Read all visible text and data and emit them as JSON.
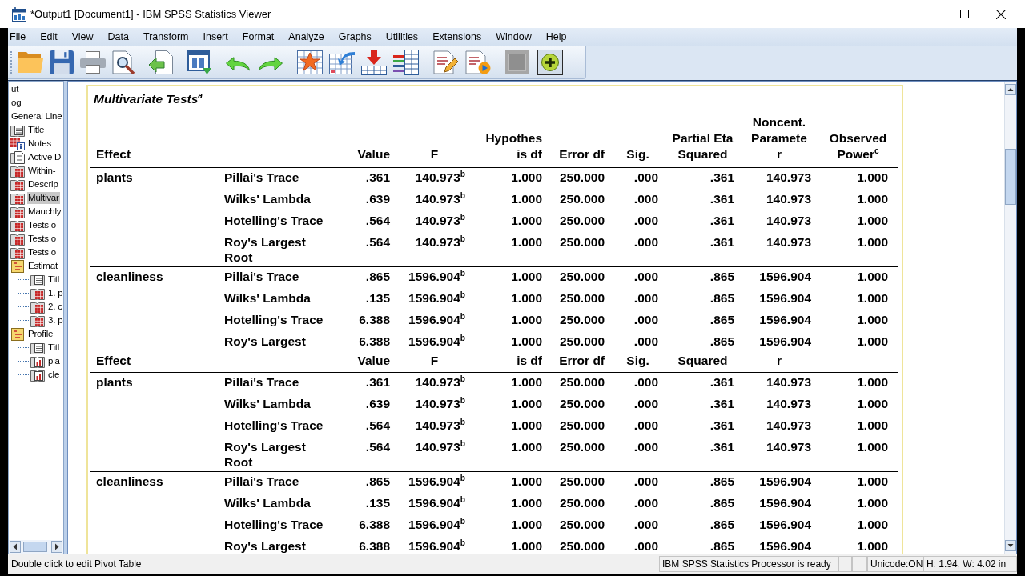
{
  "window": {
    "title": "*Output1 [Document1] - IBM SPSS Statistics Viewer"
  },
  "menu": [
    "File",
    "Edit",
    "View",
    "Data",
    "Transform",
    "Insert",
    "Format",
    "Analyze",
    "Graphs",
    "Utilities",
    "Extensions",
    "Window",
    "Help"
  ],
  "outline": {
    "items": [
      {
        "label": "ut",
        "selected": false
      },
      {
        "label": "og",
        "selected": false
      },
      {
        "label": "General Line",
        "selected": false,
        "children": [
          {
            "label": "Title",
            "kind": "title",
            "selected": false
          },
          {
            "label": "Notes",
            "kind": "notes",
            "selected": false
          },
          {
            "label": "Active D",
            "kind": "text",
            "selected": false
          },
          {
            "label": "Within-",
            "kind": "table",
            "selected": false
          },
          {
            "label": "Descrip",
            "kind": "table",
            "selected": false
          },
          {
            "label": "Multivar",
            "kind": "table",
            "selected": true
          },
          {
            "label": "Mauchly",
            "kind": "table",
            "selected": false
          },
          {
            "label": "Tests o",
            "kind": "table",
            "selected": false
          },
          {
            "label": "Tests o",
            "kind": "table",
            "selected": false
          },
          {
            "label": "Tests o",
            "kind": "table",
            "selected": false
          },
          {
            "label": "Estimat",
            "kind": "heading",
            "selected": false,
            "children": [
              {
                "label": "Titl",
                "kind": "title",
                "selected": false
              },
              {
                "label": "1. p",
                "kind": "table",
                "selected": false
              },
              {
                "label": "2. c",
                "kind": "table",
                "selected": false
              },
              {
                "label": "3. p",
                "kind": "table",
                "selected": false
              }
            ]
          },
          {
            "label": "Profile",
            "kind": "heading",
            "selected": false,
            "children": [
              {
                "label": "Titl",
                "kind": "title",
                "selected": false
              },
              {
                "label": "pla",
                "kind": "chart",
                "selected": false
              },
              {
                "label": "cle",
                "kind": "chart",
                "selected": false
              }
            ]
          }
        ]
      }
    ]
  },
  "pivot_table": {
    "title": "Multivariate Tests$^{a}$",
    "selected": true,
    "columns": [
      {
        "lines": [
          "Effect"
        ]
      },
      {
        "lines": [
          "Value"
        ]
      },
      {
        "lines": [
          "F"
        ]
      },
      {
        "lines": [
          "Hypothes",
          "is df"
        ]
      },
      {
        "lines": [
          "Error df"
        ]
      },
      {
        "lines": [
          "Sig."
        ]
      },
      {
        "lines": [
          "Partial Eta",
          "Squared"
        ]
      },
      {
        "lines": [
          "Noncent.",
          "Paramete",
          "r"
        ]
      },
      {
        "lines": [
          "Observed",
          "Power$^{c}$"
        ]
      }
    ],
    "sections": [
      {
        "kind": "group",
        "effect": "plants",
        "rows": [
          {
            "test": "Pillai's Trace",
            "values": [
              ".361",
              "140.973$^{b}$",
              "1.000",
              "250.000",
              ".000",
              ".361",
              "140.973",
              "1.000"
            ]
          },
          {
            "test": "Wilks' Lambda",
            "values": [
              ".639",
              "140.973$^{b}$",
              "1.000",
              "250.000",
              ".000",
              ".361",
              "140.973",
              "1.000"
            ]
          },
          {
            "test": "Hotelling's Trace",
            "values": [
              ".564",
              "140.973$^{b}$",
              "1.000",
              "250.000",
              ".000",
              ".361",
              "140.973",
              "1.000"
            ]
          },
          {
            "test": "Roy's Largest Root",
            "values": [
              ".564",
              "140.973$^{b}$",
              "1.000",
              "250.000",
              ".000",
              ".361",
              "140.973",
              "1.000"
            ]
          }
        ]
      },
      {
        "kind": "group",
        "effect": "cleanliness",
        "rows": [
          {
            "test": "Pillai's Trace",
            "values": [
              ".865",
              "1596.904$^{b}$",
              "1.000",
              "250.000",
              ".000",
              ".865",
              "1596.904",
              "1.000"
            ]
          },
          {
            "test": "Wilks' Lambda",
            "values": [
              ".135",
              "1596.904$^{b}$",
              "1.000",
              "250.000",
              ".000",
              ".865",
              "1596.904",
              "1.000"
            ]
          },
          {
            "test": "Hotelling's Trace",
            "values": [
              "6.388",
              "1596.904$^{b}$",
              "1.000",
              "250.000",
              ".000",
              ".865",
              "1596.904",
              "1.000"
            ]
          },
          {
            "test": "Roy's Largest",
            "values": [
              "6.388",
              "1596.904$^{b}$",
              "1.000",
              "250.000",
              ".000",
              ".865",
              "1596.904",
              "1.000"
            ]
          }
        ]
      },
      {
        "kind": "header",
        "labels": [
          "Effect",
          "Value",
          "F",
          "is df",
          "Error df",
          "Sig.",
          "Squared",
          "r"
        ]
      },
      {
        "kind": "group",
        "effect": "plants",
        "rows": [
          {
            "test": "Pillai's Trace",
            "values": [
              ".361",
              "140.973$^{b}$",
              "1.000",
              "250.000",
              ".000",
              ".361",
              "140.973",
              "1.000"
            ]
          },
          {
            "test": "Wilks' Lambda",
            "values": [
              ".639",
              "140.973$^{b}$",
              "1.000",
              "250.000",
              ".000",
              ".361",
              "140.973",
              "1.000"
            ]
          },
          {
            "test": "Hotelling's Trace",
            "values": [
              ".564",
              "140.973$^{b}$",
              "1.000",
              "250.000",
              ".000",
              ".361",
              "140.973",
              "1.000"
            ]
          },
          {
            "test": "Roy's Largest Root",
            "values": [
              ".564",
              "140.973$^{b}$",
              "1.000",
              "250.000",
              ".000",
              ".361",
              "140.973",
              "1.000"
            ]
          }
        ]
      },
      {
        "kind": "group",
        "effect": "cleanliness",
        "rows": [
          {
            "test": "Pillai's Trace",
            "values": [
              ".865",
              "1596.904$^{b}$",
              "1.000",
              "250.000",
              ".000",
              ".865",
              "1596.904",
              "1.000"
            ]
          },
          {
            "test": "Wilks' Lambda",
            "values": [
              ".135",
              "1596.904$^{b}$",
              "1.000",
              "250.000",
              ".000",
              ".865",
              "1596.904",
              "1.000"
            ]
          },
          {
            "test": "Hotelling's Trace",
            "values": [
              "6.388",
              "1596.904$^{b}$",
              "1.000",
              "250.000",
              ".000",
              ".865",
              "1596.904",
              "1.000"
            ]
          },
          {
            "test": "Roy's Largest",
            "values": [
              "6.388",
              "1596.904$^{b}$",
              "1.000",
              "250.000",
              ".000",
              ".865",
              "1596.904",
              "1.000"
            ]
          }
        ]
      }
    ]
  },
  "status_bar": {
    "message": "Double click to edit Pivot Table",
    "processor": "IBM SPSS Statistics Processor is ready",
    "unicode": "Unicode:ON",
    "size": "H: 1.94, W: 4.02 in"
  }
}
